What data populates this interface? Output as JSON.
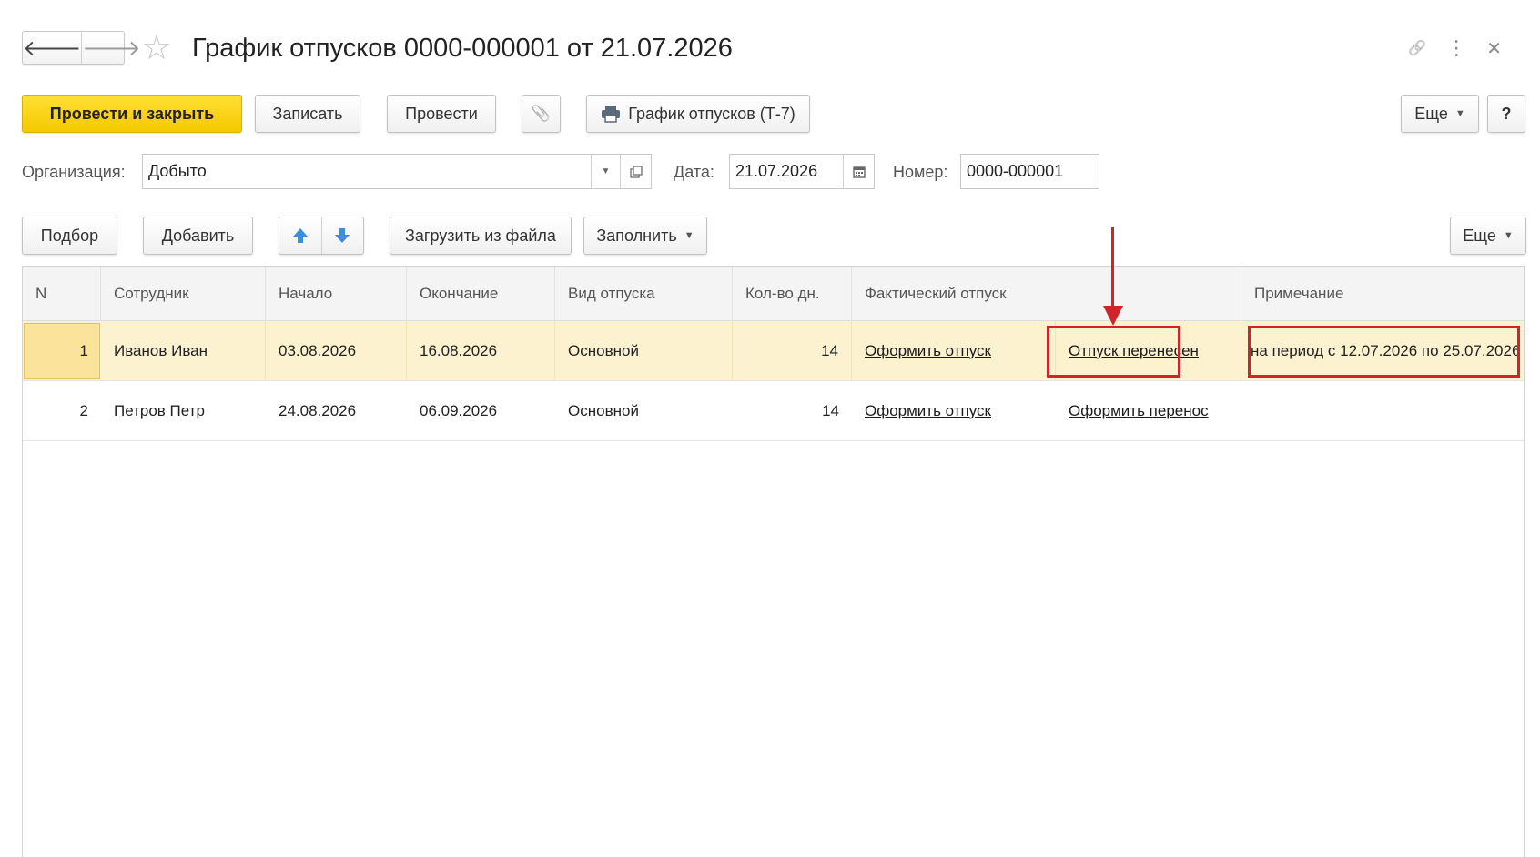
{
  "window": {
    "title": "График отпусков 0000-000001 от 21.07.2026",
    "nav_back": "🡐",
    "nav_forward": "🡒",
    "favorite_icon": "☆",
    "link_icon": "🔗",
    "menu_icon": "⋮",
    "close_icon": "✕"
  },
  "toolbar": {
    "post_close_label": "Провести и закрыть",
    "save_label": "Записать",
    "post_label": "Провести",
    "attach_icon": "📎",
    "print_label": "График отпусков (Т-7)",
    "more_label": "Еще",
    "help_label": "?"
  },
  "form": {
    "org_label": "Организация:",
    "org_value": "Добыто",
    "date_label": "Дата:",
    "date_value": "21.07.2026",
    "number_label": "Номер:",
    "number_value": "0000-000001"
  },
  "table_toolbar": {
    "pick_label": "Подбор",
    "add_label": "Добавить",
    "up_icon": "🡅",
    "down_icon": "🡇",
    "load_label": "Загрузить из файла",
    "fill_label": "Заполнить",
    "more_label": "Еще"
  },
  "table": {
    "columns": {
      "n": "N",
      "employee": "Сотрудник",
      "start": "Начало",
      "end": "Окончание",
      "type": "Вид отпуска",
      "days": "Кол-во дн.",
      "actual": "Фактический отпуск",
      "note": "Примечание"
    },
    "rows": [
      {
        "n": "1",
        "employee": "Иванов Иван",
        "start": "03.08.2026",
        "end": "16.08.2026",
        "type": "Основной",
        "days": "14",
        "actual_link": "Оформить отпуск",
        "transfer_link": "Отпуск перенесен",
        "note": "на период с 12.07.2026 по 25.07.2026"
      },
      {
        "n": "2",
        "employee": "Петров Петр",
        "start": "24.08.2026",
        "end": "06.09.2026",
        "type": "Основной",
        "days": "14",
        "actual_link": "Оформить отпуск",
        "transfer_link": "Оформить перенос",
        "note": ""
      }
    ]
  },
  "colors": {
    "primary_button": "#f5c800",
    "selected_row": "#fcf2cf",
    "annotation": "#d2232a",
    "arrow_blue": "#3a8fd8"
  }
}
